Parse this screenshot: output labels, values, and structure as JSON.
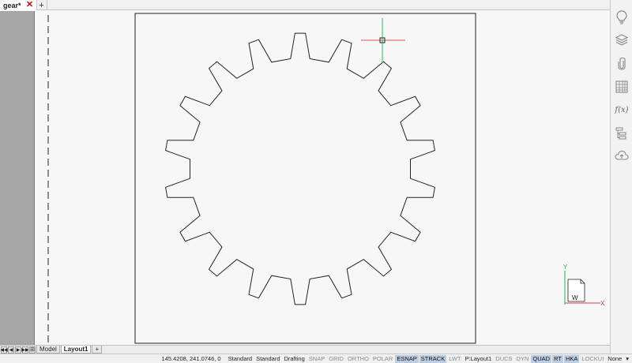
{
  "document_tab": {
    "name": "gear*"
  },
  "tab_add_label": "+",
  "layout_nav": [
    "◀◀",
    "◀",
    "▶",
    "▶▶"
  ],
  "layout_tabs": [
    {
      "label": "Model",
      "active": false
    },
    {
      "label": "Layout1",
      "active": true
    }
  ],
  "layout_add_label": "+",
  "coordinates": "145.4208, 241.0746, 0",
  "status": {
    "text_style": "Standard",
    "dim_style": "Standard",
    "workspace": "Drafting",
    "toggles": [
      {
        "label": "SNAP",
        "state": "off"
      },
      {
        "label": "GRID",
        "state": "off"
      },
      {
        "label": "ORTHO",
        "state": "off"
      },
      {
        "label": "POLAR",
        "state": "off"
      },
      {
        "label": "ESNAP",
        "state": "on"
      },
      {
        "label": "STRACK",
        "state": "on"
      },
      {
        "label": "LWT",
        "state": "off"
      }
    ],
    "layout_label": "P:Layout1",
    "toggles2": [
      {
        "label": "DUCS",
        "state": "off"
      },
      {
        "label": "DYN",
        "state": "off"
      },
      {
        "label": "QUAD",
        "state": "on"
      },
      {
        "label": "RT",
        "state": "on"
      },
      {
        "label": "HKA",
        "state": "on"
      },
      {
        "label": "LOCKUI",
        "state": "off"
      }
    ],
    "annotation": "None",
    "menu_arrow": "▾"
  },
  "ucs": {
    "y_label": "Y",
    "x_label": "X",
    "w_label": "W"
  },
  "right_panel_icons": [
    "lightbulb-icon",
    "layers-icon",
    "paperclip-icon",
    "hatch-icon",
    "function-icon",
    "hierarchy-icon",
    "cloud-upload-icon"
  ],
  "function_glyph": "f(x)",
  "colors": {
    "crosshair_x": "#e05050",
    "crosshair_y": "#20c070",
    "ucs_x": "#d04040",
    "ucs_y": "#20b060",
    "status_on": "#bccde3"
  },
  "gear": {
    "teeth": 18
  }
}
